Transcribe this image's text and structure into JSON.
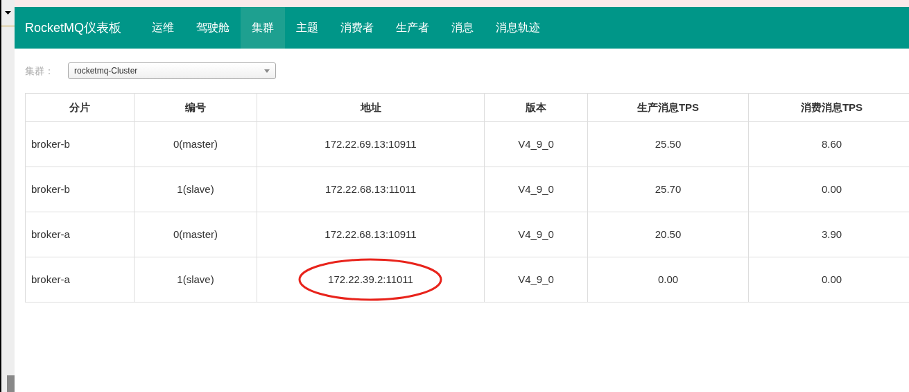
{
  "nav": {
    "brand": "RocketMQ仪表板",
    "items": [
      {
        "label": "运维",
        "selected": false
      },
      {
        "label": "驾驶舱",
        "selected": false
      },
      {
        "label": "集群",
        "selected": true
      },
      {
        "label": "主题",
        "selected": false
      },
      {
        "label": "消费者",
        "selected": false
      },
      {
        "label": "生产者",
        "selected": false
      },
      {
        "label": "消息",
        "selected": false
      },
      {
        "label": "消息轨迹",
        "selected": false
      }
    ]
  },
  "cluster_filter": {
    "label": "集群：",
    "value": "rocketmq-Cluster"
  },
  "table": {
    "columns": [
      "分片",
      "编号",
      "地址",
      "版本",
      "生产消息TPS",
      "消费消息TPS"
    ],
    "rows": [
      {
        "cells": [
          "broker-b",
          "0(master)",
          "172.22.69.13:10911",
          "V4_9_0",
          "25.50",
          "8.60"
        ],
        "circled": false
      },
      {
        "cells": [
          "broker-b",
          "1(slave)",
          "172.22.68.13:11011",
          "V4_9_0",
          "25.70",
          "0.00"
        ],
        "circled": false
      },
      {
        "cells": [
          "broker-a",
          "0(master)",
          "172.22.68.13:10911",
          "V4_9_0",
          "20.50",
          "3.90"
        ],
        "circled": false
      },
      {
        "cells": [
          "broker-a",
          "1(slave)",
          "172.22.39.2:11011",
          "V4_9_0",
          "0.00",
          "0.00"
        ],
        "circled": true
      }
    ]
  }
}
